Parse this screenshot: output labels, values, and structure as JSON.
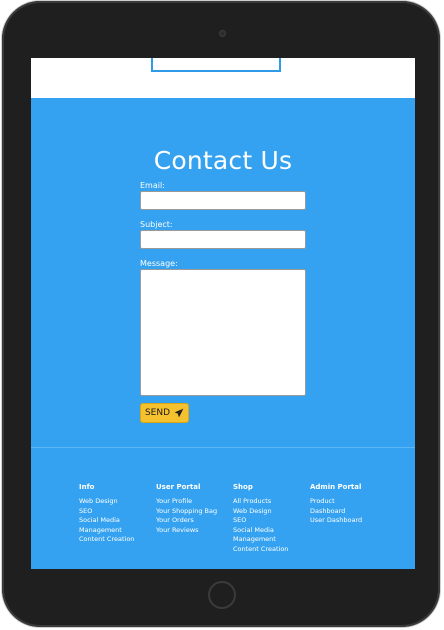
{
  "contact": {
    "title": "Contact Us",
    "email_label": "Email:",
    "email_value": "",
    "subject_label": "Subject:",
    "subject_value": "",
    "message_label": "Message:",
    "message_value": "",
    "send_label": "SEND",
    "send_icon": "paper-plane-icon"
  },
  "footer": {
    "columns": [
      {
        "heading": "Info",
        "links": [
          "Web Design",
          "SEO",
          "Social Media Management",
          "Content Creation"
        ]
      },
      {
        "heading": "User Portal",
        "links": [
          "Your Profile",
          "Your Shopping Bag",
          "Your Orders",
          "Your Reviews"
        ]
      },
      {
        "heading": "Shop",
        "links": [
          "All Products",
          "Web Design",
          "SEO",
          "Social Media Management",
          "Content Creation"
        ]
      },
      {
        "heading": "Admin Portal",
        "links": [
          "Product",
          "Dashboard",
          "User Dashboard"
        ]
      }
    ]
  },
  "colors": {
    "primary_blue": "#34a2f0",
    "send_yellow": "#f5c12e",
    "device_frame": "#1f1f1f"
  }
}
